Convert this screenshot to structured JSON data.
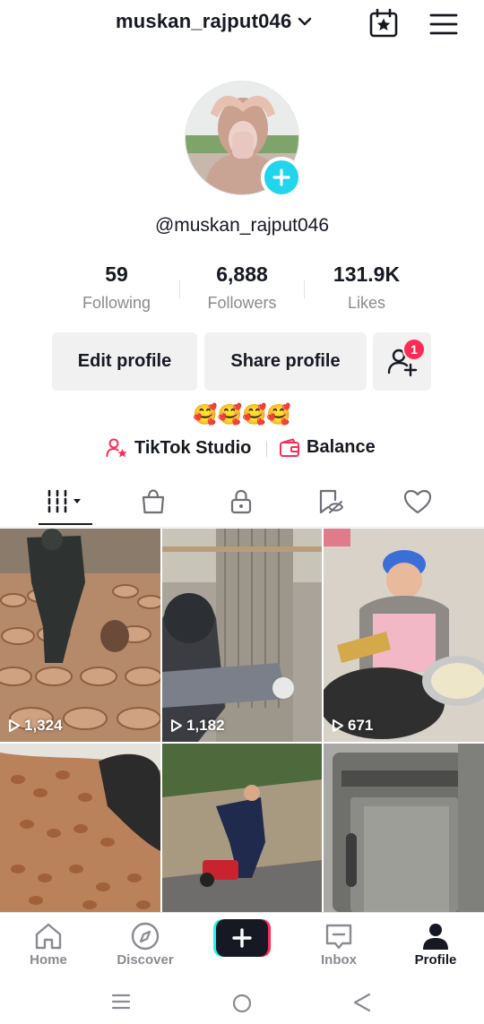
{
  "header": {
    "username": "muskan_rajput046",
    "icons": [
      "chevron-down-icon",
      "calendar-star-icon",
      "hamburger-menu-icon"
    ]
  },
  "profile": {
    "handle": "@muskan_rajput046",
    "stats": [
      {
        "value": "59",
        "label": "Following"
      },
      {
        "value": "6,888",
        "label": "Followers"
      },
      {
        "value": "131.9K",
        "label": "Likes"
      }
    ],
    "edit_label": "Edit profile",
    "share_label": "Share profile",
    "add_friends_badge": "1",
    "bio": "🥰🥰🥰🥰",
    "studio_label": "TikTok Studio",
    "balance_label": "Balance"
  },
  "tabs": [
    "videos-grid-icon",
    "shop-bag-icon",
    "lock-icon",
    "favorites-icon",
    "liked-heart-icon"
  ],
  "videos": [
    {
      "views": "1,324"
    },
    {
      "views": "1,182"
    },
    {
      "views": "671"
    },
    {
      "views": ""
    },
    {
      "views": ""
    },
    {
      "views": ""
    }
  ],
  "nav": {
    "home": "Home",
    "discover": "Discover",
    "inbox": "Inbox",
    "profile": "Profile"
  },
  "colors": {
    "accent": "#fe2c55",
    "cyan": "#20d5ec",
    "text": "#161823",
    "muted": "#8a8b91"
  }
}
